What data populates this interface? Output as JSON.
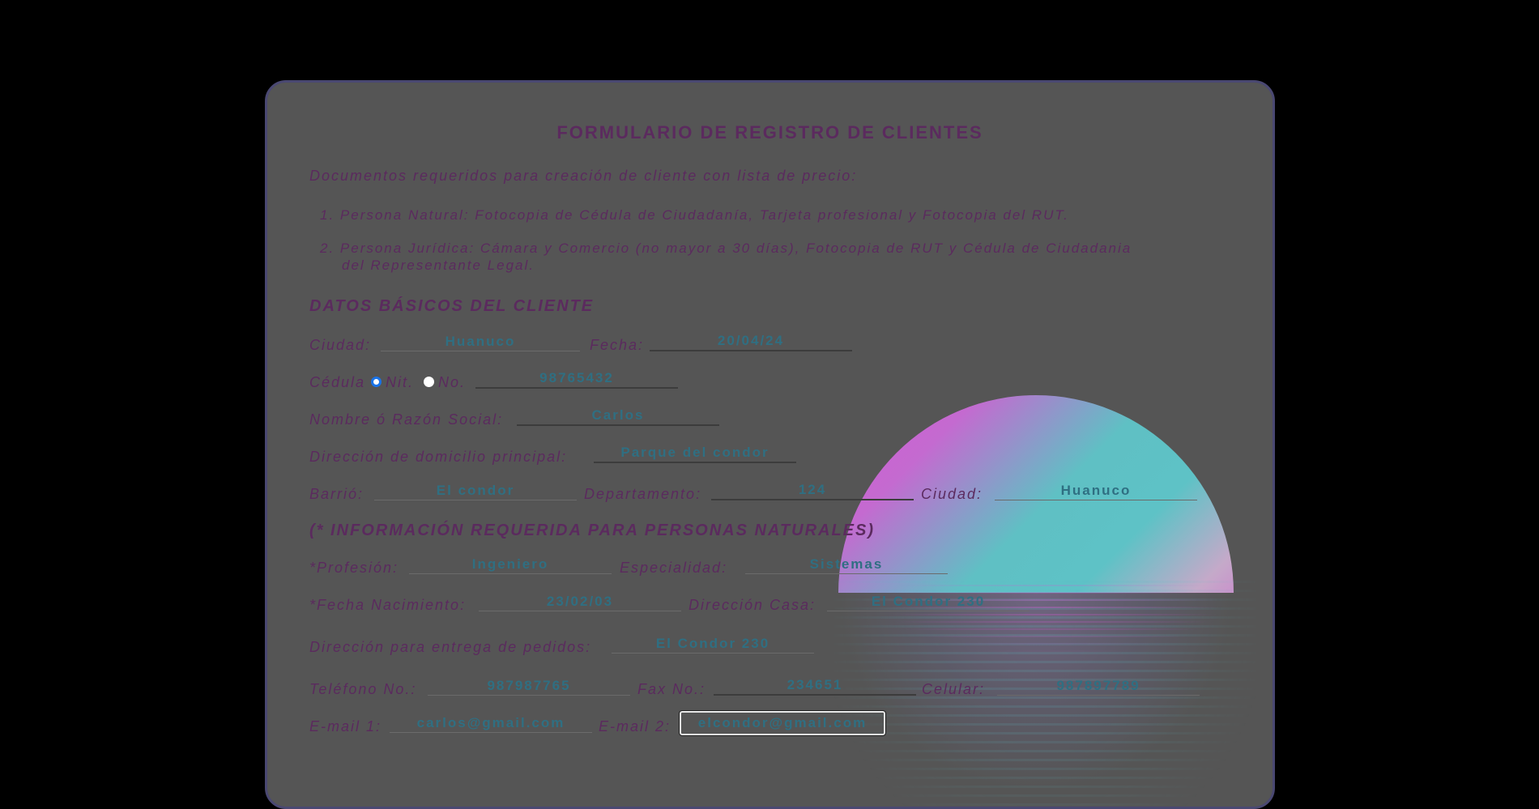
{
  "form": {
    "title": "FORMULARIO DE REGISTRO DE CLIENTES",
    "intro": "Documentos requeridos para creación de cliente con lista de precio:",
    "requirements": [
      "1. Persona Natural: Fotocopia de Cédula de Ciudadanía, Tarjeta profesional y Fotocopia del RUT.",
      "2. Persona Jurídica: Cámara y Comercio (no mayor a 30 días), Fotocopia de RUT y Cédula de Ciudadania",
      "del Representante Legal."
    ],
    "section_basic": "DATOS BÁSICOS DEL CLIENTE",
    "section_natural": "(* INFORMACIÓN REQUERIDA PARA PERSONAS NATURALES)"
  },
  "labels": {
    "ciudad": "Ciudad:",
    "fecha": "Fecha:",
    "cedula": "Cédula",
    "nit": "Nit.",
    "no": "No.",
    "nombre": "Nombre ó Razón Social:",
    "direccion_principal": "Dirección de domicilio principal:",
    "barrio": "Barrió:",
    "departamento": "Departamento:",
    "ciudad2": "Ciudad:",
    "profesion": "*Profesión:",
    "especialidad": "Especialidad:",
    "fecha_nacimiento": "*Fecha Nacimiento:",
    "direccion_casa": "Dirección Casa:",
    "direccion_pedidos": "Dirección para entrega de pedidos:",
    "telefono": "Teléfono No.:",
    "fax": "Fax No.:",
    "celular": "Celular:",
    "email1": "E-mail 1:",
    "email2": "E-mail 2:"
  },
  "values": {
    "ciudad": "Huanuco",
    "fecha": "20/04/24",
    "id_type_selected": "Cédula",
    "numero": "98765432",
    "nombre": "Carlos",
    "direccion_principal": "Parque del condor",
    "barrio": "El condor",
    "departamento": "124",
    "ciudad2": "Huanuco",
    "profesion": "Ingeniero",
    "especialidad": "Sistemas",
    "fecha_nacimiento": "23/02/03",
    "direccion_casa": "El Condor 230",
    "direccion_pedidos": "El Condor 230",
    "telefono": "987987765",
    "fax": "234651",
    "celular": "987897789",
    "email1": "carlos@gmail.com",
    "email2": "elcondor@gmail.com"
  },
  "colors": {
    "background": "#000000",
    "card": "#555555",
    "card_border": "#4a4872",
    "label_text": "#5b2a5e",
    "input_text": "#2f6f82"
  }
}
